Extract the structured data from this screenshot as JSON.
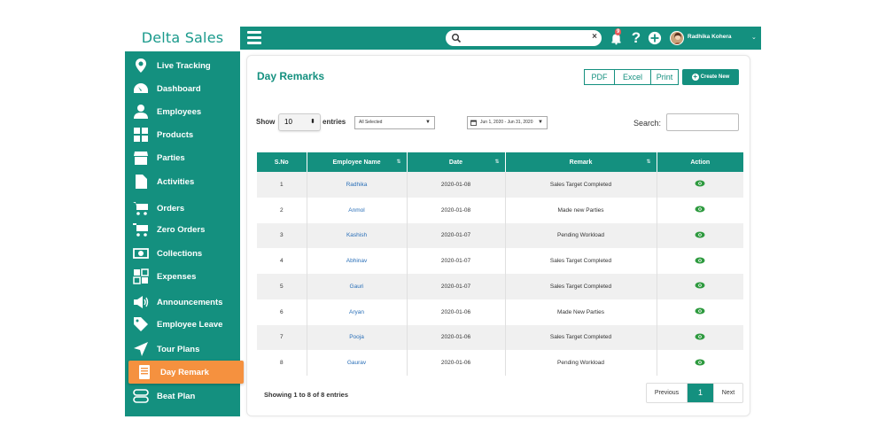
{
  "brand": "Delta Sales",
  "topbar": {
    "search_placeholder": "",
    "search_clear": "×",
    "help": "?",
    "add": "+",
    "username": "Radhika Kohera",
    "caret": "⌄",
    "notification_badge": "9"
  },
  "sidebar": {
    "items": [
      {
        "label": "Live Tracking",
        "icon": "location-pin-icon"
      },
      {
        "label": "Dashboard",
        "icon": "gauge-icon"
      },
      {
        "label": "Employees",
        "icon": "person-icon"
      },
      {
        "label": "Products",
        "icon": "grid-icon"
      },
      {
        "label": "Parties",
        "icon": "store-icon"
      },
      {
        "label": "Activities",
        "icon": "document-icon"
      },
      {
        "label": "Orders",
        "icon": "cart-icon"
      },
      {
        "label": "Zero Orders",
        "icon": "cart-icon"
      },
      {
        "label": "Collections",
        "icon": "banknote-icon"
      },
      {
        "label": "Expenses",
        "icon": "squares-icon"
      },
      {
        "label": "Announcements",
        "icon": "megaphone-icon"
      },
      {
        "label": "Employee Leave",
        "icon": "tag-icon"
      },
      {
        "label": "Tour Plans",
        "icon": "paper-plane-icon"
      },
      {
        "label": "Day Remark",
        "icon": "notebook-icon"
      },
      {
        "label": "Beat Plan",
        "icon": "beat-plan-icon"
      }
    ],
    "active": "Day Remark"
  },
  "main": {
    "title": "Day Remarks",
    "export_buttons": [
      "PDF",
      "Excel",
      "Print"
    ],
    "create_label": "Create New",
    "show_label": "Show",
    "entries_label": "entries",
    "page_size": "10",
    "employee_filter": "All Selected",
    "date_range": "Jun 1, 2020 - Jun 31, 2020",
    "search_label": "Search:",
    "search_value": ""
  },
  "table": {
    "columns": [
      "S.No",
      "Employee Name",
      "Date",
      "Remark",
      "Action"
    ],
    "rows": [
      {
        "sno": "1",
        "employee": "Radhika",
        "date": "2020-01-08",
        "remark": "Sales Target Completed"
      },
      {
        "sno": "2",
        "employee": "Anmol",
        "date": "2020-01-08",
        "remark": "Made new Parties"
      },
      {
        "sno": "3",
        "employee": "Kashish",
        "date": "2020-01-07",
        "remark": "Pending Workload"
      },
      {
        "sno": "4",
        "employee": "Abhinav",
        "date": "2020-01-07",
        "remark": "Sales Target Completed"
      },
      {
        "sno": "5",
        "employee": "Gauri",
        "date": "2020-01-07",
        "remark": "Sales Target Completed"
      },
      {
        "sno": "6",
        "employee": "Aryan",
        "date": "2020-01-06",
        "remark": "Made New Parties"
      },
      {
        "sno": "7",
        "employee": "Pooja",
        "date": "2020-01-06",
        "remark": "Sales Target Completed"
      },
      {
        "sno": "8",
        "employee": "Gaurav",
        "date": "2020-01-06",
        "remark": "Pending Workload"
      }
    ]
  },
  "footer": {
    "showing": "Showing 1 to 8 of 8 entries",
    "previous": "Previous",
    "page": "1",
    "next": "Next"
  },
  "colors": {
    "primary": "#14907f",
    "active": "#f5913f",
    "link": "#2a6fb8",
    "eye": "#2e9a3f"
  }
}
